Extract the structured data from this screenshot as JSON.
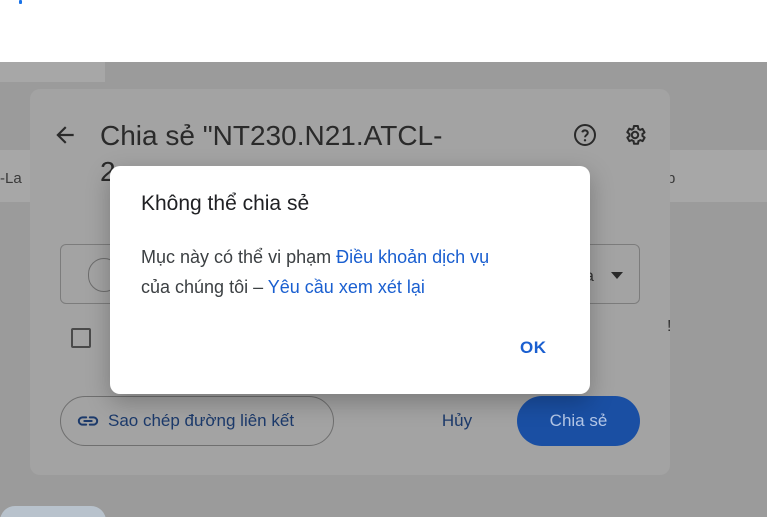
{
  "background": {
    "left_fragment": "-La",
    "right_fragment": "b"
  },
  "share_dialog": {
    "title_line1": "Chia sẻ \"NT230.N21.ATCL-",
    "title_line2": "2",
    "role_label": "a",
    "right_mark": "!",
    "copy_link_label": "Sao chép đường liên kết",
    "cancel_label": "Hủy",
    "share_label": "Chia sẻ"
  },
  "modal": {
    "title": "Không thể chia sẻ",
    "body_prefix": "Mục này có thể vi phạm ",
    "terms_link": "Điều khoản dịch vụ",
    "body_middle": "của chúng tôi – ",
    "review_link": "Yêu cầu xem xét lại",
    "ok_label": "OK"
  },
  "colors": {
    "accent": "#1a5fd0",
    "share_button": "#1a4fa3",
    "scrim": "#9b9b9b"
  }
}
